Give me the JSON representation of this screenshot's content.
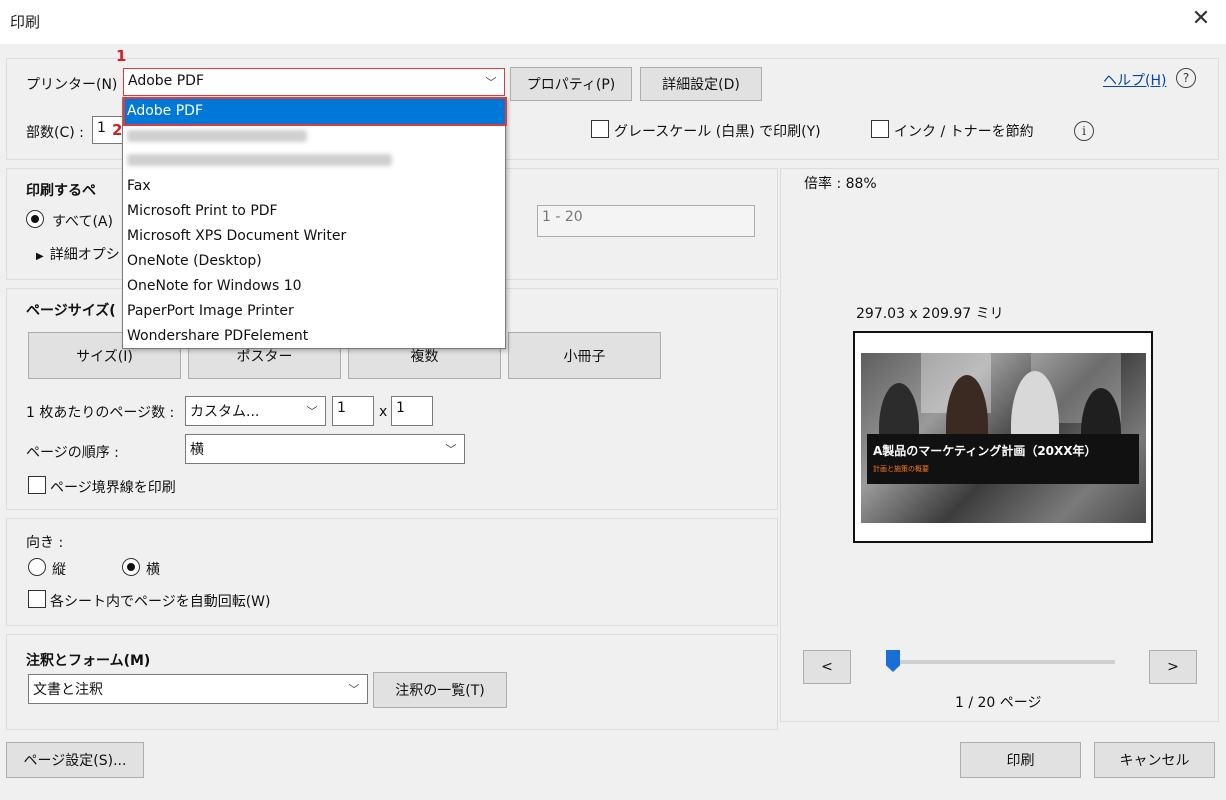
{
  "window": {
    "title": "印刷"
  },
  "printer": {
    "label": "プリンター(N) :",
    "selected": "Adobe PDF",
    "properties_button": "プロパティ(P)",
    "advanced_button": "詳細設定(D)",
    "help_link": "ヘルプ(H)",
    "options": [
      "Adobe PDF",
      "Fax",
      "Microsoft Print to PDF",
      "Microsoft XPS Document Writer",
      "OneNote (Desktop)",
      "OneNote for Windows 10",
      "PaperPort Image Printer",
      "Wondershare PDFelement"
    ]
  },
  "copies": {
    "label": "部数(C) :",
    "value": "1"
  },
  "grayscale": {
    "label": "グレースケール (白黒) で印刷(Y)"
  },
  "save_ink": {
    "label": "インク / トナーを節約"
  },
  "pages_section": {
    "title": "印刷するペ",
    "all_label": "すべて(A)",
    "more_options": "詳細オプシ",
    "range_value": "1 - 20"
  },
  "page_size_section": {
    "title": "ページサイズ(",
    "buttons": [
      "サイズ(I)",
      "ポスター",
      "複数",
      "小冊子"
    ],
    "pages_per_sheet_label": "1 枚あたりのページ数 :",
    "pages_per_sheet_value": "カスタム...",
    "cols": "1",
    "x": "x",
    "rows": "1",
    "order_label": "ページの順序 :",
    "order_value": "横",
    "border_label": "ページ境界線を印刷"
  },
  "orientation": {
    "label": "向き :",
    "portrait": "縦",
    "landscape": "横",
    "auto_rotate": "各シート内でページを自動回転(W)"
  },
  "annotations": {
    "title": "注釈とフォーム(M)",
    "value": "文書と注釈",
    "summary_button": "注釈の一覧(T)"
  },
  "preview": {
    "zoom": "倍率 : 88%",
    "size": "297.03 x 209.97 ミリ",
    "slide_title": "A製品のマーケティング計画（20XX年）",
    "slide_subtitle": "計画と施策の概要",
    "prev": "<",
    "next": ">",
    "page_indicator": "1 / 20 ページ",
    "current_page": 1,
    "total_pages": 20
  },
  "footer": {
    "page_setup": "ページ設定(S)...",
    "print": "印刷",
    "cancel": "キャンセル"
  },
  "callouts": [
    "1",
    "2"
  ]
}
